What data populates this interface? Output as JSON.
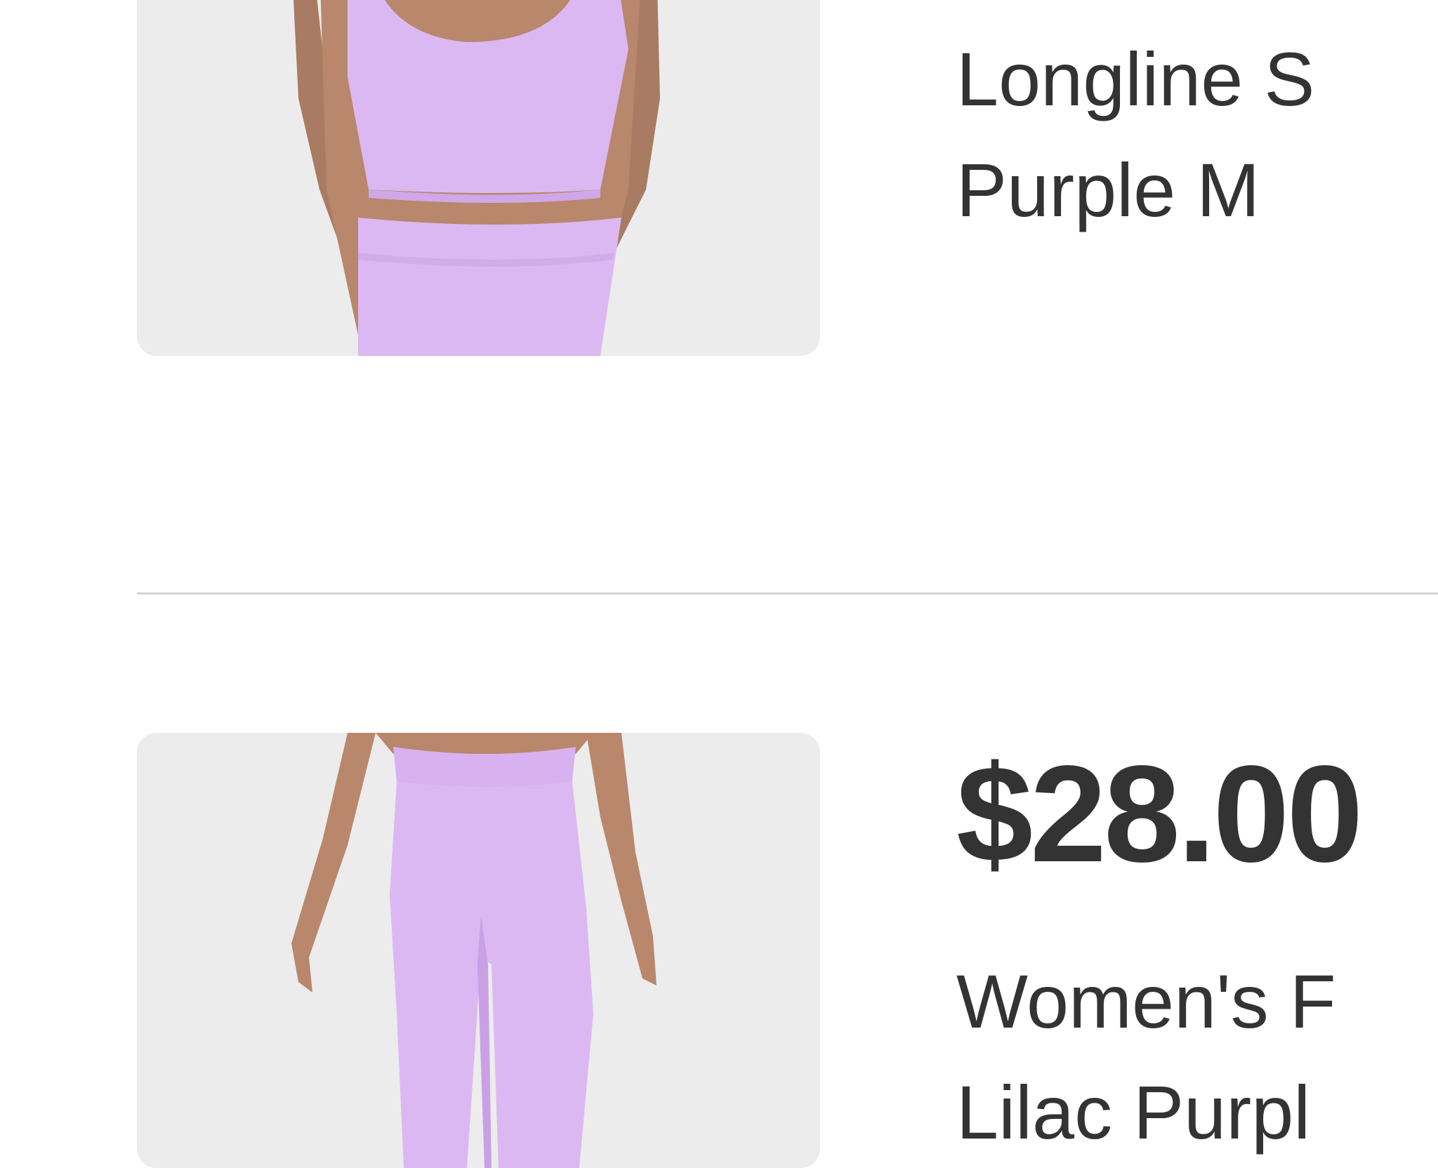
{
  "products": [
    {
      "image_alt": "lilac purple longline sports bra",
      "title_line1": "Longline S",
      "title_line2": "Purple M"
    },
    {
      "image_alt": "lilac purple leggings",
      "price": "$28.00",
      "title_line1": "Women's F",
      "title_line2": "Lilac Purpl"
    }
  ],
  "colors": {
    "text": "#333333",
    "divider": "#d4d4d4",
    "image_bg": "#ececec",
    "garment": "#dcb8f2"
  }
}
